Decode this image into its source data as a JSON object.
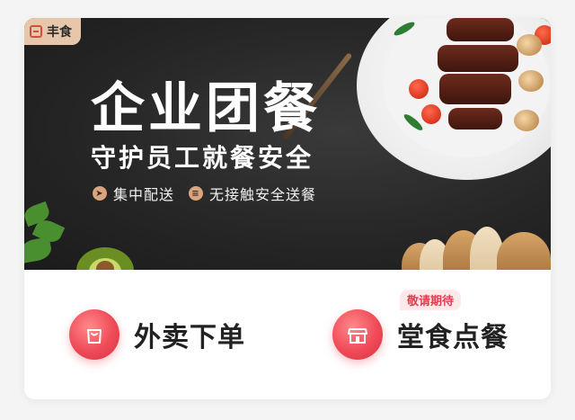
{
  "banner": {
    "brand": "丰食",
    "headline": "企业团餐",
    "subline": "守护员工就餐安全",
    "features": [
      {
        "icon": "delivery-icon",
        "label": "集中配送"
      },
      {
        "icon": "contactless-icon",
        "label": "无接触安全送餐"
      }
    ]
  },
  "actions": [
    {
      "label": "外卖下单",
      "icon": "shopping-bag-icon"
    },
    {
      "label": "堂食点餐",
      "icon": "storefront-icon",
      "badge": "敬请期待"
    }
  ],
  "colors": {
    "accent": "#ef4a58",
    "badge_bg": "#fde8ea",
    "badge_text": "#e23d4e",
    "brand_tag": "#e7c7ab"
  }
}
